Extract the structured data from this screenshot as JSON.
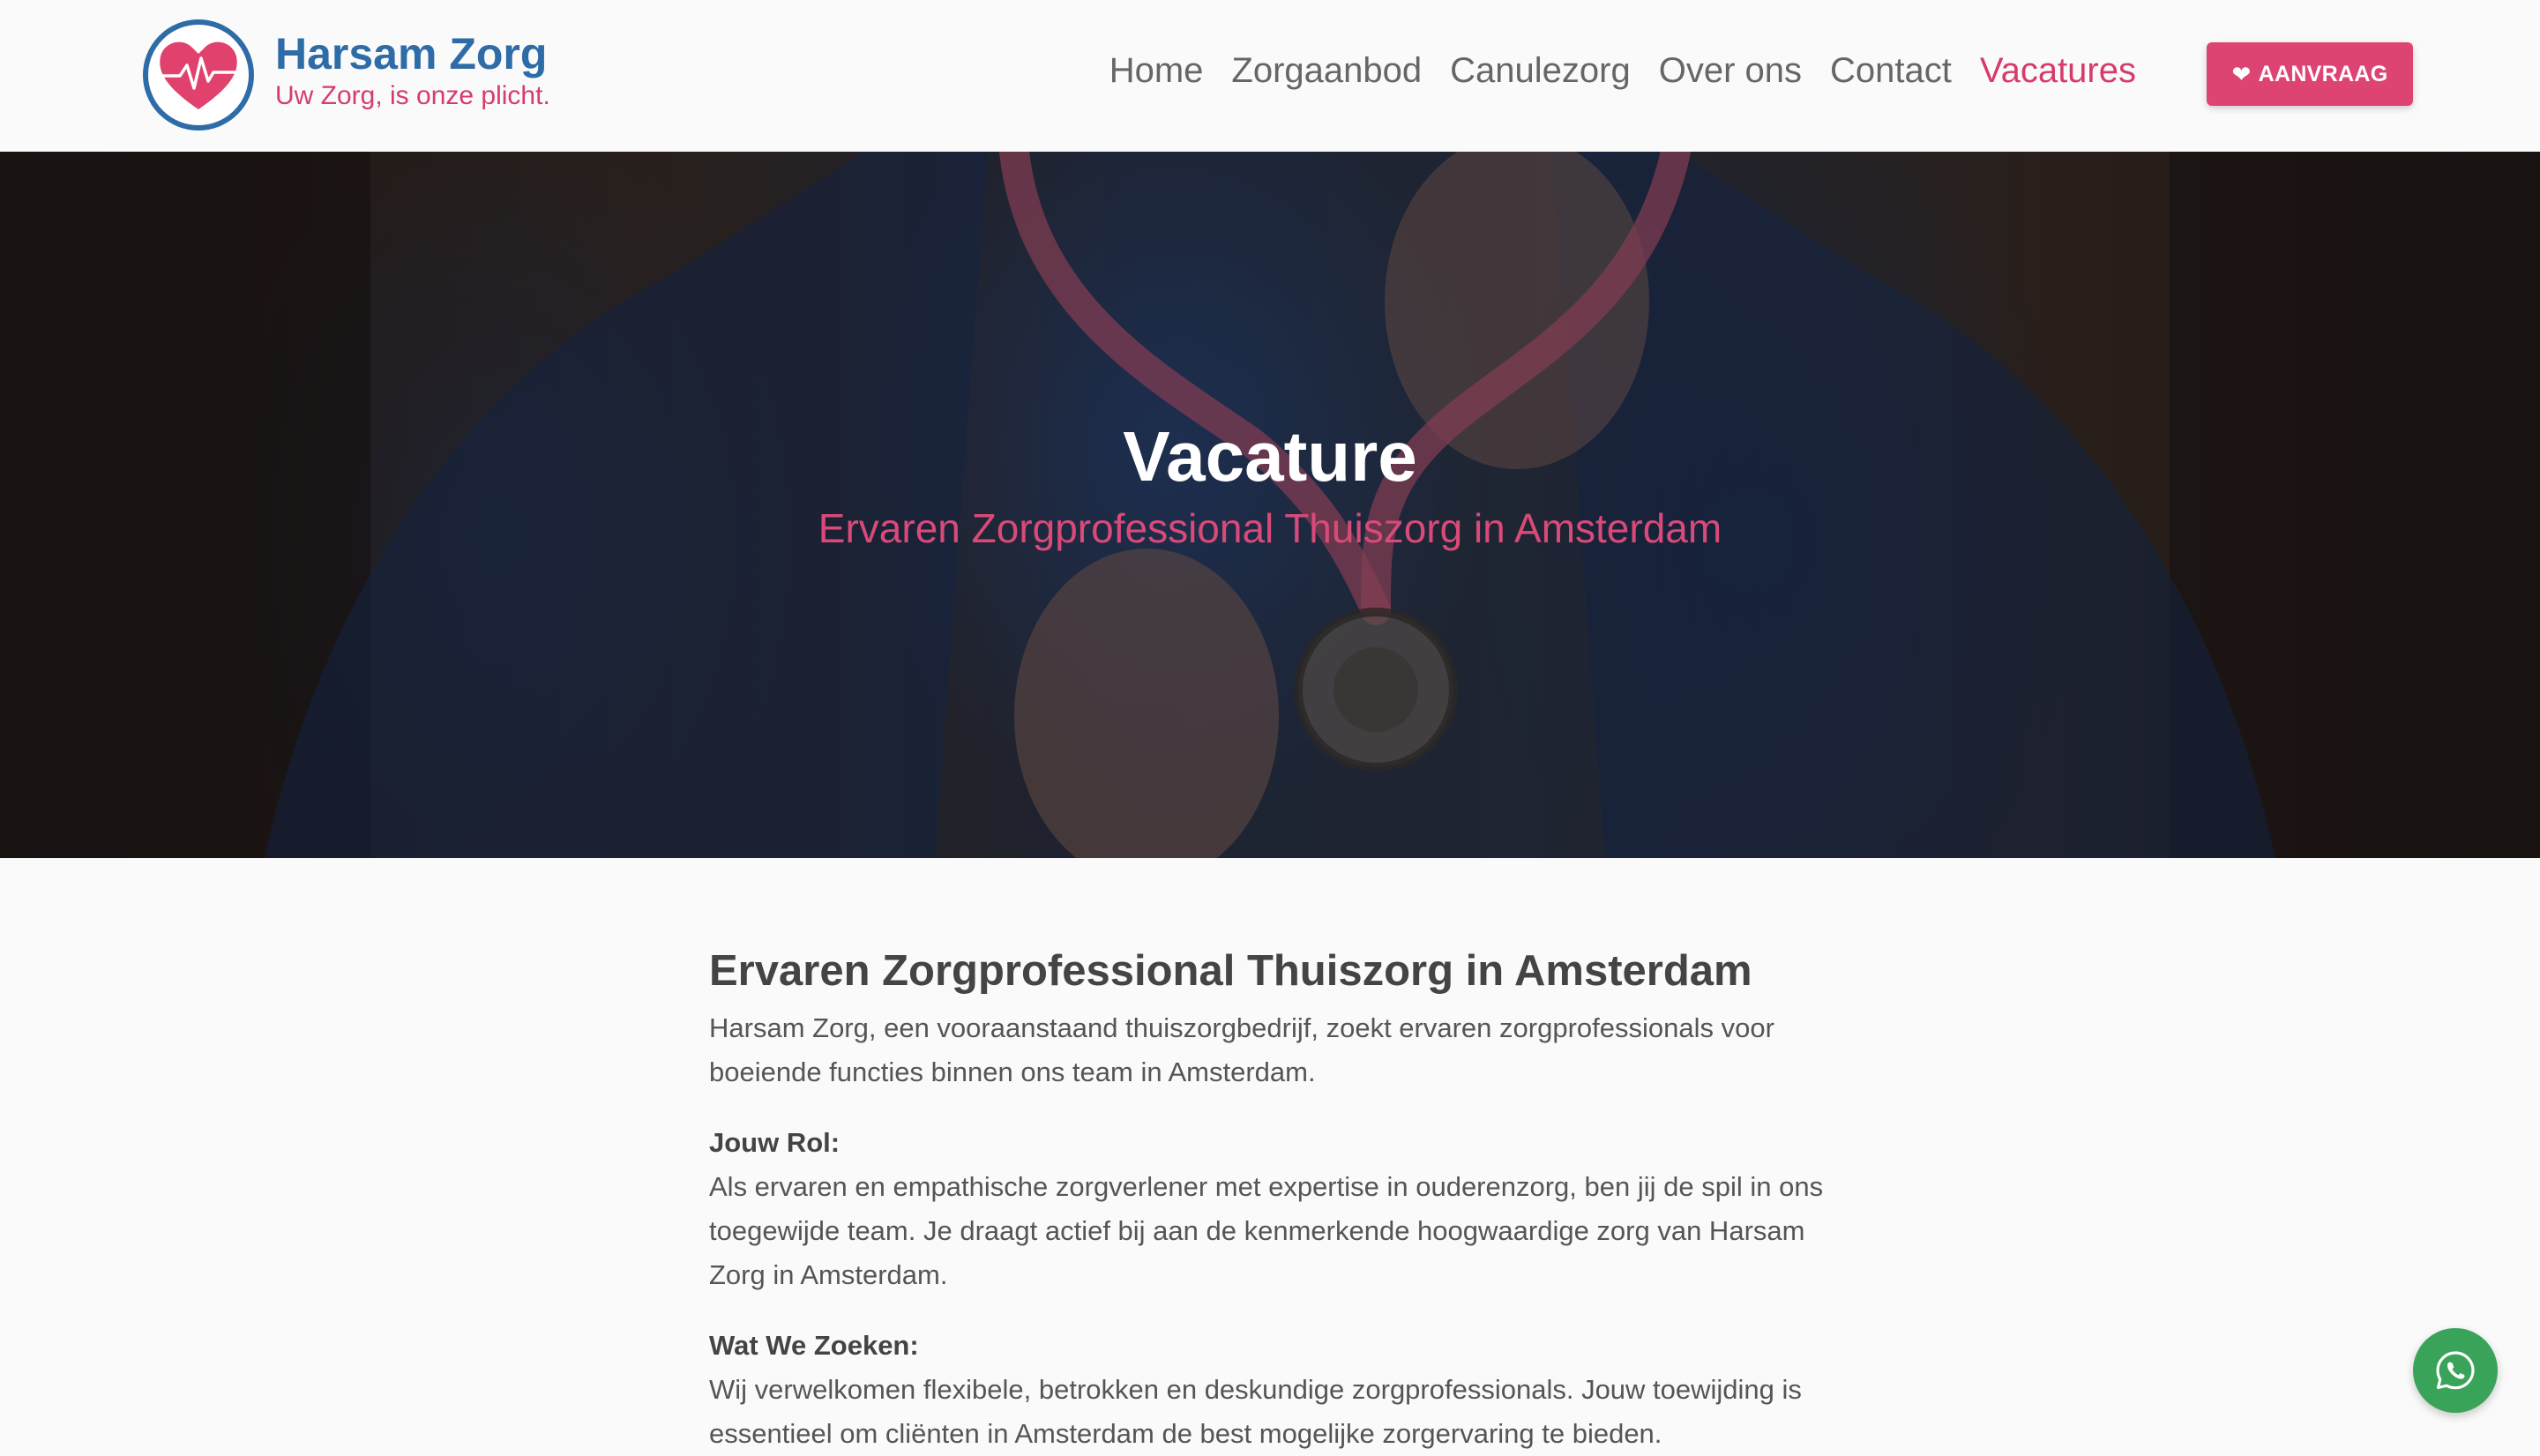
{
  "brand": {
    "name": "Harsam Zorg",
    "tagline": "Uw Zorg, is onze plicht."
  },
  "nav": {
    "items": [
      {
        "label": "Home"
      },
      {
        "label": "Zorgaanbod"
      },
      {
        "label": "Canulezorg"
      },
      {
        "label": "Over ons"
      },
      {
        "label": "Contact"
      },
      {
        "label": "Vacatures",
        "active": true
      }
    ],
    "cta_label": "AANVRAAG"
  },
  "hero": {
    "title": "Vacature",
    "subtitle": "Ervaren Zorgprofessional Thuiszorg in Amsterdam"
  },
  "article": {
    "heading": "Ervaren Zorgprofessional Thuiszorg in Amsterdam",
    "intro": "Harsam Zorg, een vooraanstaand thuiszorgbedrijf, zoekt ervaren zorgprofessionals voor boeiende functies binnen ons team in Amsterdam.",
    "sections": [
      {
        "title": "Jouw Rol:",
        "body": "Als ervaren en empathische zorgverlener met expertise in ouderenzorg, ben jij de spil in ons toegewijde team. Je draagt actief bij aan de kenmerkende hoogwaardige zorg van Harsam Zorg in Amsterdam."
      },
      {
        "title": "Wat We Zoeken:",
        "body": "Wij verwelkomen flexibele, betrokken en deskundige zorgprofessionals. Jouw toewijding is essentieel om cliënten in Amsterdam de best mogelijke zorgervaring te bieden."
      }
    ]
  },
  "icons": {
    "logo": "heart-pulse-icon",
    "cta": "heart-icon",
    "float": "whatsapp-icon"
  },
  "colors": {
    "brand_blue": "#2e6ca8",
    "accent_pink": "#d63c6a",
    "cta_bg": "#dd4472",
    "whatsapp_green": "#3aa35a"
  }
}
